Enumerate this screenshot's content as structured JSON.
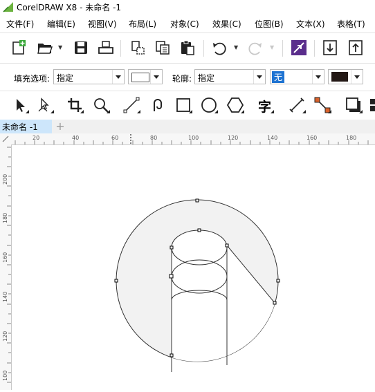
{
  "window": {
    "title": "CorelDRAW X8 - 未命名 -1",
    "logo_icon": "coreldraw-logo-icon",
    "logo_color": "#6cb33f"
  },
  "menu": [
    {
      "label": "文件(F)"
    },
    {
      "label": "编辑(E)"
    },
    {
      "label": "视图(V)"
    },
    {
      "label": "布局(L)"
    },
    {
      "label": "对象(C)"
    },
    {
      "label": "效果(C)"
    },
    {
      "label": "位图(B)"
    },
    {
      "label": "文本(X)"
    },
    {
      "label": "表格(T)"
    }
  ],
  "standard_toolbar": [
    {
      "icon": "new-document-icon"
    },
    {
      "icon": "open-folder-icon"
    },
    {
      "icon": "save-icon"
    },
    {
      "icon": "print-icon"
    },
    {
      "icon": "cut-icon"
    },
    {
      "icon": "copy-icon"
    },
    {
      "icon": "paste-icon"
    },
    {
      "icon": "undo-icon"
    },
    {
      "icon": "redo-icon"
    },
    {
      "icon": "search-content-icon"
    },
    {
      "icon": "import-icon"
    },
    {
      "icon": "export-icon"
    }
  ],
  "property_bar": {
    "fill_label": "填充选项:",
    "fill_value": "指定",
    "outline_label": "轮廓:",
    "outline_value": "指定",
    "outline_width": "无",
    "outline_color": "#231815",
    "accent": "#1e73d2"
  },
  "toolbox": [
    {
      "icon": "pick-tool-icon"
    },
    {
      "icon": "shape-tool-icon"
    },
    {
      "icon": "crop-tool-icon"
    },
    {
      "icon": "zoom-tool-icon"
    },
    {
      "icon": "freehand-tool-icon"
    },
    {
      "icon": "artistic-media-icon"
    },
    {
      "icon": "rectangle-tool-icon"
    },
    {
      "icon": "ellipse-tool-icon"
    },
    {
      "icon": "polygon-tool-icon"
    },
    {
      "icon": "text-tool-icon"
    },
    {
      "icon": "dimension-tool-icon"
    },
    {
      "icon": "connector-tool-icon"
    },
    {
      "icon": "drop-shadow-tool-icon"
    }
  ],
  "text_tool_glyph": "字",
  "document_tab": {
    "label": "未命名 -1",
    "add_label": "+"
  },
  "rulers": {
    "horizontal_labels": [
      "20",
      "40",
      "60",
      "80",
      "100",
      "120",
      "140",
      "160",
      "180"
    ],
    "vertical_labels": [
      "200",
      "180",
      "160",
      "140",
      "120",
      "100"
    ]
  },
  "canvas": {
    "shape_fill": "#f2f2f2",
    "stroke": "#333333"
  }
}
